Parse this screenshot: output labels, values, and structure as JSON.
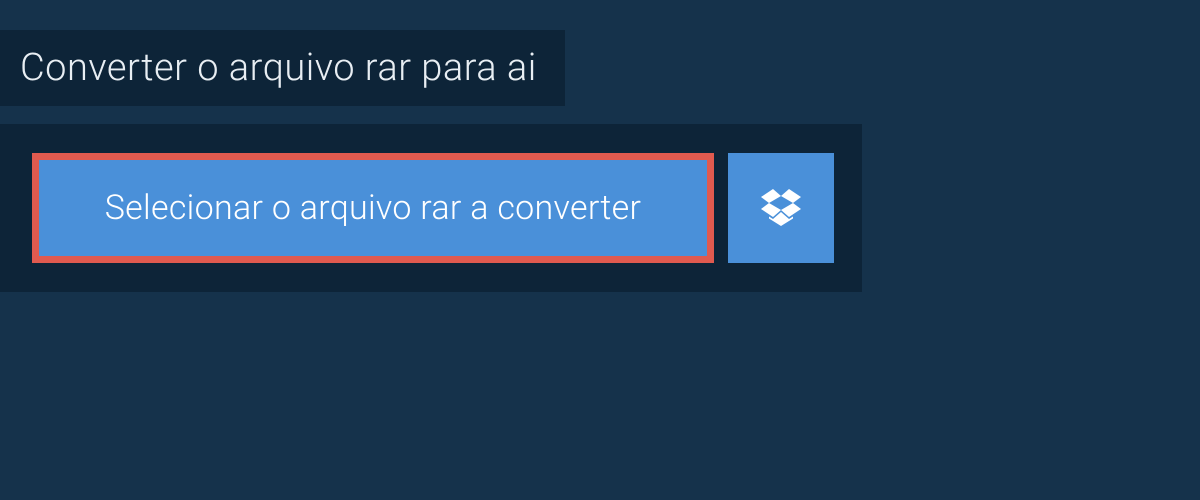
{
  "header": {
    "title": "Converter o arquivo rar para ai"
  },
  "actions": {
    "select_file_label": "Selecionar o arquivo rar a converter"
  },
  "colors": {
    "background": "#15324b",
    "panel": "#0d2438",
    "button": "#4a90d9",
    "highlight_border": "#e05a4f",
    "text_light": "#e8eef3",
    "text_white": "#ffffff"
  }
}
